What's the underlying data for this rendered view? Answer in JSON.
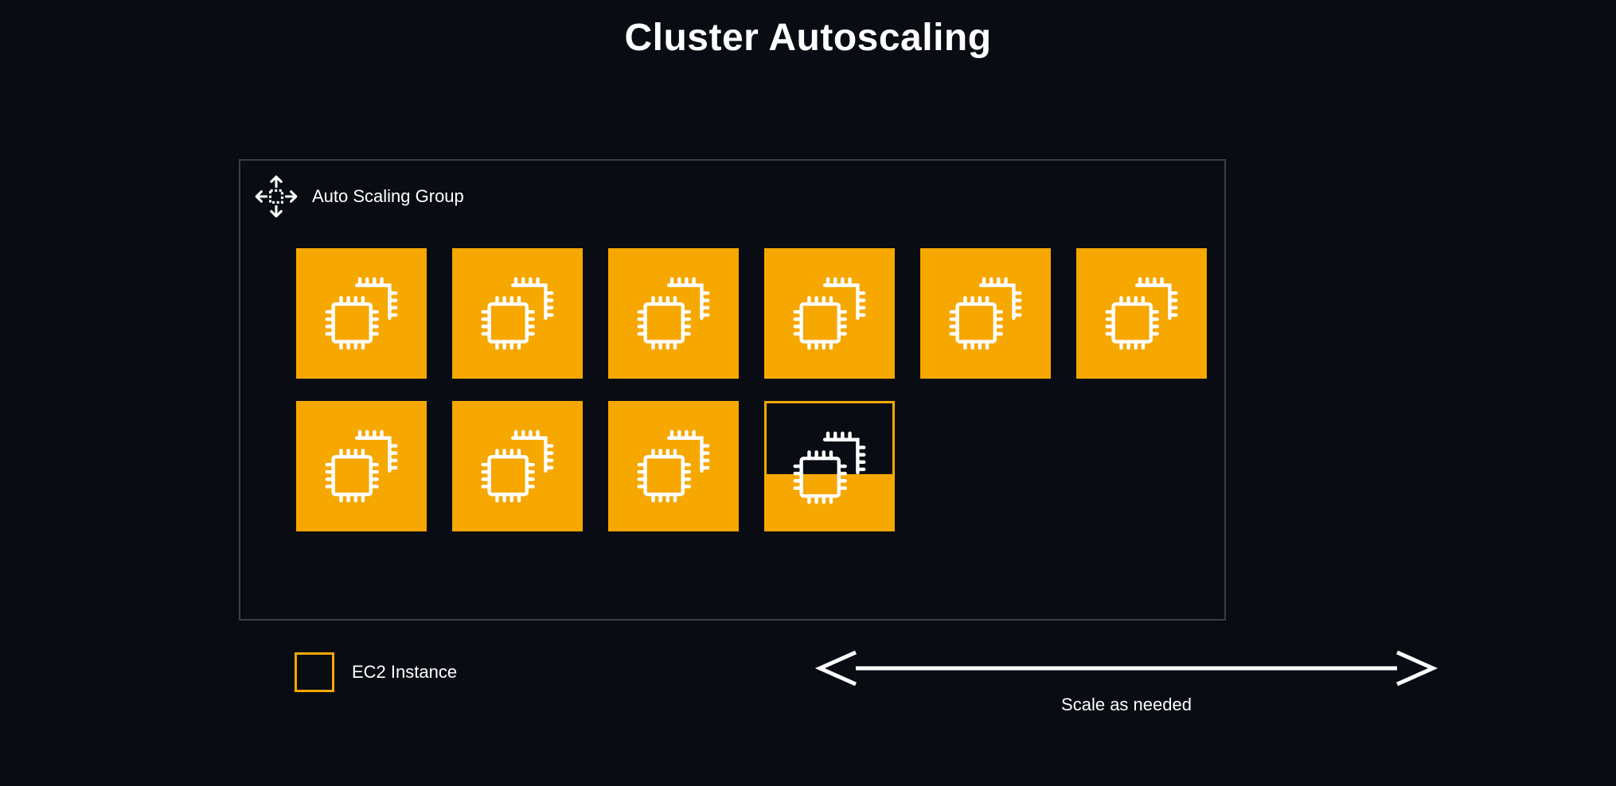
{
  "title": "Cluster Autoscaling",
  "asg_label": "Auto Scaling Group",
  "legend_label": "EC2 Instance",
  "scale_caption": "Scale as needed",
  "instances_row1": 6,
  "instances_row2_full": 3,
  "instances_row2_partial": 1,
  "colors": {
    "accent": "#f6a700",
    "background": "#090d13",
    "stroke_light": "#ffffff",
    "box_border": "#3a3f45"
  },
  "icons": {
    "asg": "auto-scaling-group-icon",
    "chip": "ec2-chip-icon"
  }
}
